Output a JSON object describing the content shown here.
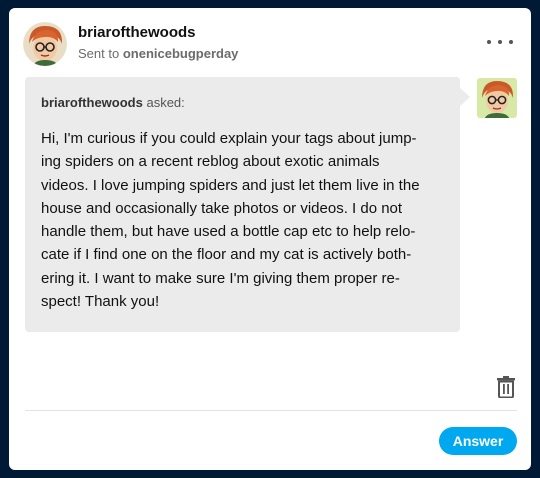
{
  "post": {
    "username": "briarofthewoods",
    "sent_prefix": "Sent to",
    "recipient": "onenicebugperday",
    "more_icon": "ellipsis-icon"
  },
  "question": {
    "asker": "briarofthewoods",
    "asked_label": "asked:",
    "text": "Hi, I'm curious if you could explain your tags about jump-\ning spiders on a recent reblog about exotic animals\nvideos. I love jumping spiders and just let them live in the\nhouse and occasionally take photos or videos. I do not\nhandle them, but have used a bottle cap etc to help relo-\ncate if I find one on the floor and my cat is actively both-\nering it. I want to make sure I'm giving them proper re-\nspect! Thank you!"
  },
  "actions": {
    "delete_icon": "trash-icon",
    "answer_label": "Answer"
  },
  "colors": {
    "page_background": "#001935",
    "answer_button": "#00a8f0",
    "bubble": "#ebebeb"
  }
}
